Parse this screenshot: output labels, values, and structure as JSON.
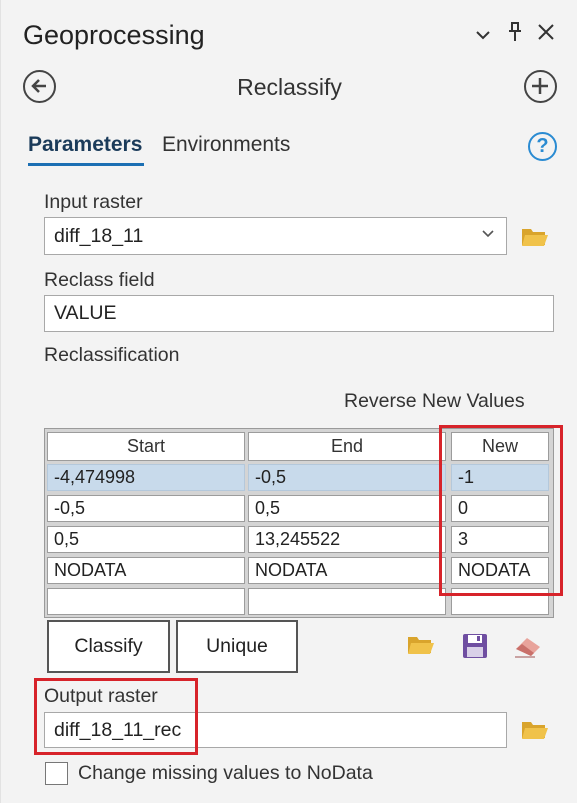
{
  "pane": {
    "title": "Geoprocessing"
  },
  "window_controls": {
    "menu_icon": "chevron-down-icon",
    "pin_icon": "pin-icon",
    "close_icon": "close-icon"
  },
  "tool": {
    "title": "Reclassify",
    "back_icon": "back-arrow-icon",
    "add_icon": "plus-circle-icon",
    "help_icon": "help-icon"
  },
  "tabs": [
    {
      "label": "Parameters",
      "active": true
    },
    {
      "label": "Environments",
      "active": false
    }
  ],
  "input_raster": {
    "label": "Input raster",
    "value": "diff_18_11"
  },
  "reclass_field": {
    "label": "Reclass field",
    "value": "VALUE"
  },
  "reclassification": {
    "label": "Reclassification",
    "reverse_label": "Reverse New Values",
    "columns": [
      "Start",
      "End",
      "New"
    ],
    "rows": [
      [
        "-4,474998",
        "-0,5",
        "-1"
      ],
      [
        "-0,5",
        "0,5",
        "0"
      ],
      [
        "0,5",
        "13,245522",
        "3"
      ],
      [
        "NODATA",
        "NODATA",
        "NODATA"
      ],
      [
        "",
        "",
        ""
      ]
    ],
    "selected_row": 0,
    "classify_label": "Classify",
    "unique_label": "Unique"
  },
  "output_raster": {
    "label": "Output raster",
    "value": "diff_18_11_rec"
  },
  "missing_values": {
    "label": "Change missing values to NoData",
    "checked": false
  },
  "colors": {
    "accent": "#1b6fb3",
    "highlight_box": "#d7232a",
    "selected_row": "#c8daeb",
    "folder": "#e7b53a"
  }
}
